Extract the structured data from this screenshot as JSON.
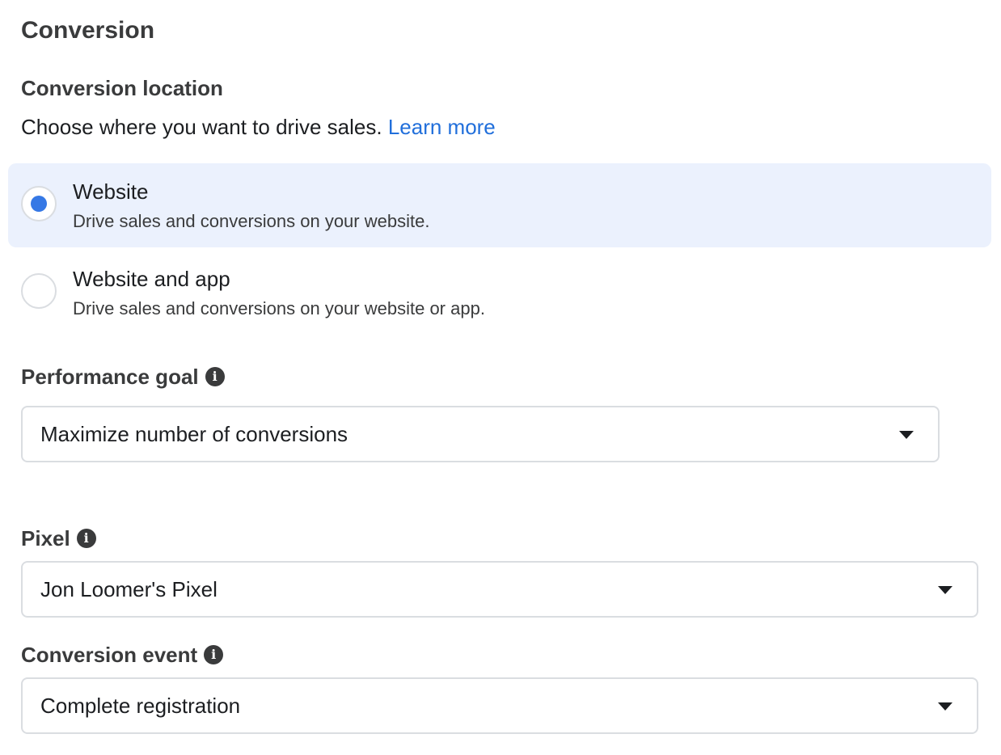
{
  "section": {
    "title": "Conversion"
  },
  "conversion_location": {
    "heading": "Conversion location",
    "description": "Choose where you want to drive sales.",
    "learn_more": "Learn more",
    "options": [
      {
        "title": "Website",
        "description": "Drive sales and conversions on your website.",
        "selected": true
      },
      {
        "title": "Website and app",
        "description": "Drive sales and conversions on your website or app.",
        "selected": false
      }
    ]
  },
  "performance_goal": {
    "label": "Performance goal",
    "value": "Maximize number of conversions"
  },
  "pixel": {
    "label": "Pixel",
    "value": "Jon Loomer's Pixel"
  },
  "conversion_event": {
    "label": "Conversion event",
    "value": "Complete registration"
  },
  "colors": {
    "accent": "#3578e5",
    "link": "#216fdb",
    "selected_bg": "#ebf1fd",
    "border": "#dadde1"
  },
  "icons": {
    "info": "info-icon",
    "dropdown": "chevron-down-icon"
  }
}
